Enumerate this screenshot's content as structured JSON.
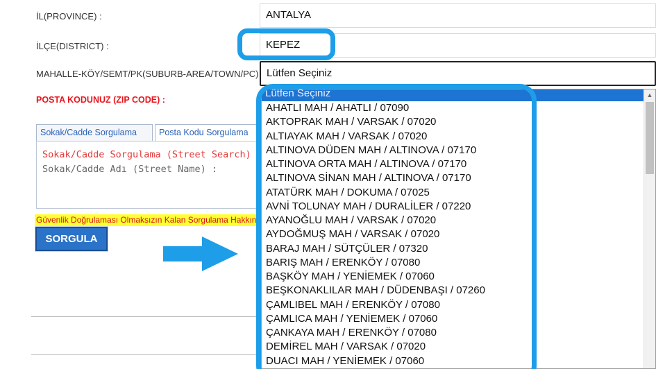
{
  "form": {
    "province_label": "İL(PROVINCE) :",
    "province_value": "ANTALYA",
    "district_label": "İLÇE(DISTRICT) :",
    "district_value": "KEPEZ",
    "suburb_label": "MAHALLE-KÖY/SEMT/PK(SUBURB-AREA/TOWN/PC) :",
    "suburb_value": "Lütfen Seçiniz",
    "zip_label": "POSTA KODUNUZ (ZIP CODE) :"
  },
  "tabs": [
    {
      "label": "Sokak/Cadde Sorgulama"
    },
    {
      "label": "Posta Kodu Sorgulama"
    }
  ],
  "panel": {
    "title": "Sokak/Cadde Sorgulama (Street Search)",
    "field_label": "Sokak/Cadde Adı (Street Name) :"
  },
  "security_note": "Güvenlik Doğrulaması Olmaksızın Kalan Sorgulama Hakkınız",
  "query_button": "SORGULA",
  "dropdown": {
    "highlighted_option": "Lütfen Seçiniz",
    "options": [
      "AHATLI MAH / AHATLI / 07090",
      "AKTOPRAK MAH / VARSAK / 07020",
      "ALTIAYAK MAH / VARSAK / 07020",
      "ALTINOVA DÜDEN MAH / ALTINOVA / 07170",
      "ALTINOVA ORTA MAH / ALTINOVA / 07170",
      "ALTINOVA SİNAN MAH / ALTINOVA / 07170",
      "ATATÜRK MAH / DOKUMA / 07025",
      "AVNİ TOLUNAY MAH / DURALİLER / 07220",
      "AYANOĞLU MAH / VARSAK / 07020",
      "AYDOĞMUŞ MAH / VARSAK / 07020",
      "BARAJ MAH / SÜTÇÜLER / 07320",
      "BARIŞ MAH / ERENKÖY / 07080",
      "BAŞKÖY MAH / YENİEMEK / 07060",
      "BEŞKONAKLILAR MAH / DÜDENBAŞI / 07260",
      "ÇAMLIBEL MAH / ERENKÖY / 07080",
      "ÇAMLICA MAH / YENİEMEK / 07060",
      "ÇANKAYA MAH / ERENKÖY / 07080",
      "DEMİREL MAH / VARSAK / 07020",
      "DUACI MAH / YENİEMEK / 07060"
    ]
  },
  "colors": {
    "highlight_outline": "#1e9de8",
    "arrow": "#1e9de8",
    "selected_option_bg": "#1e74d2",
    "zip_label": "#e8151d",
    "button_bg": "#2b73c8",
    "note_bg": "#ffff33"
  },
  "icons": {
    "arrow": "right-arrow-icon",
    "scroll_up": "chevron-up-icon"
  }
}
